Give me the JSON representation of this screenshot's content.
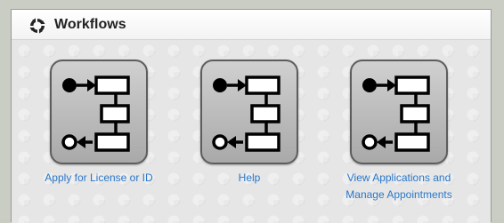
{
  "panel": {
    "title": "Workflows",
    "title_icon": "workflows-icon"
  },
  "tiles": [
    {
      "label": "Apply for License or ID",
      "icon": "workflow-diagram-icon"
    },
    {
      "label": "Help",
      "icon": "workflow-diagram-icon"
    },
    {
      "label": "View Applications and Manage Appointments",
      "icon": "workflow-diagram-icon"
    }
  ],
  "colors": {
    "link": "#2a77c9",
    "tile_bg": "#bfbfbf",
    "page_bg": "#c9cdc3"
  }
}
